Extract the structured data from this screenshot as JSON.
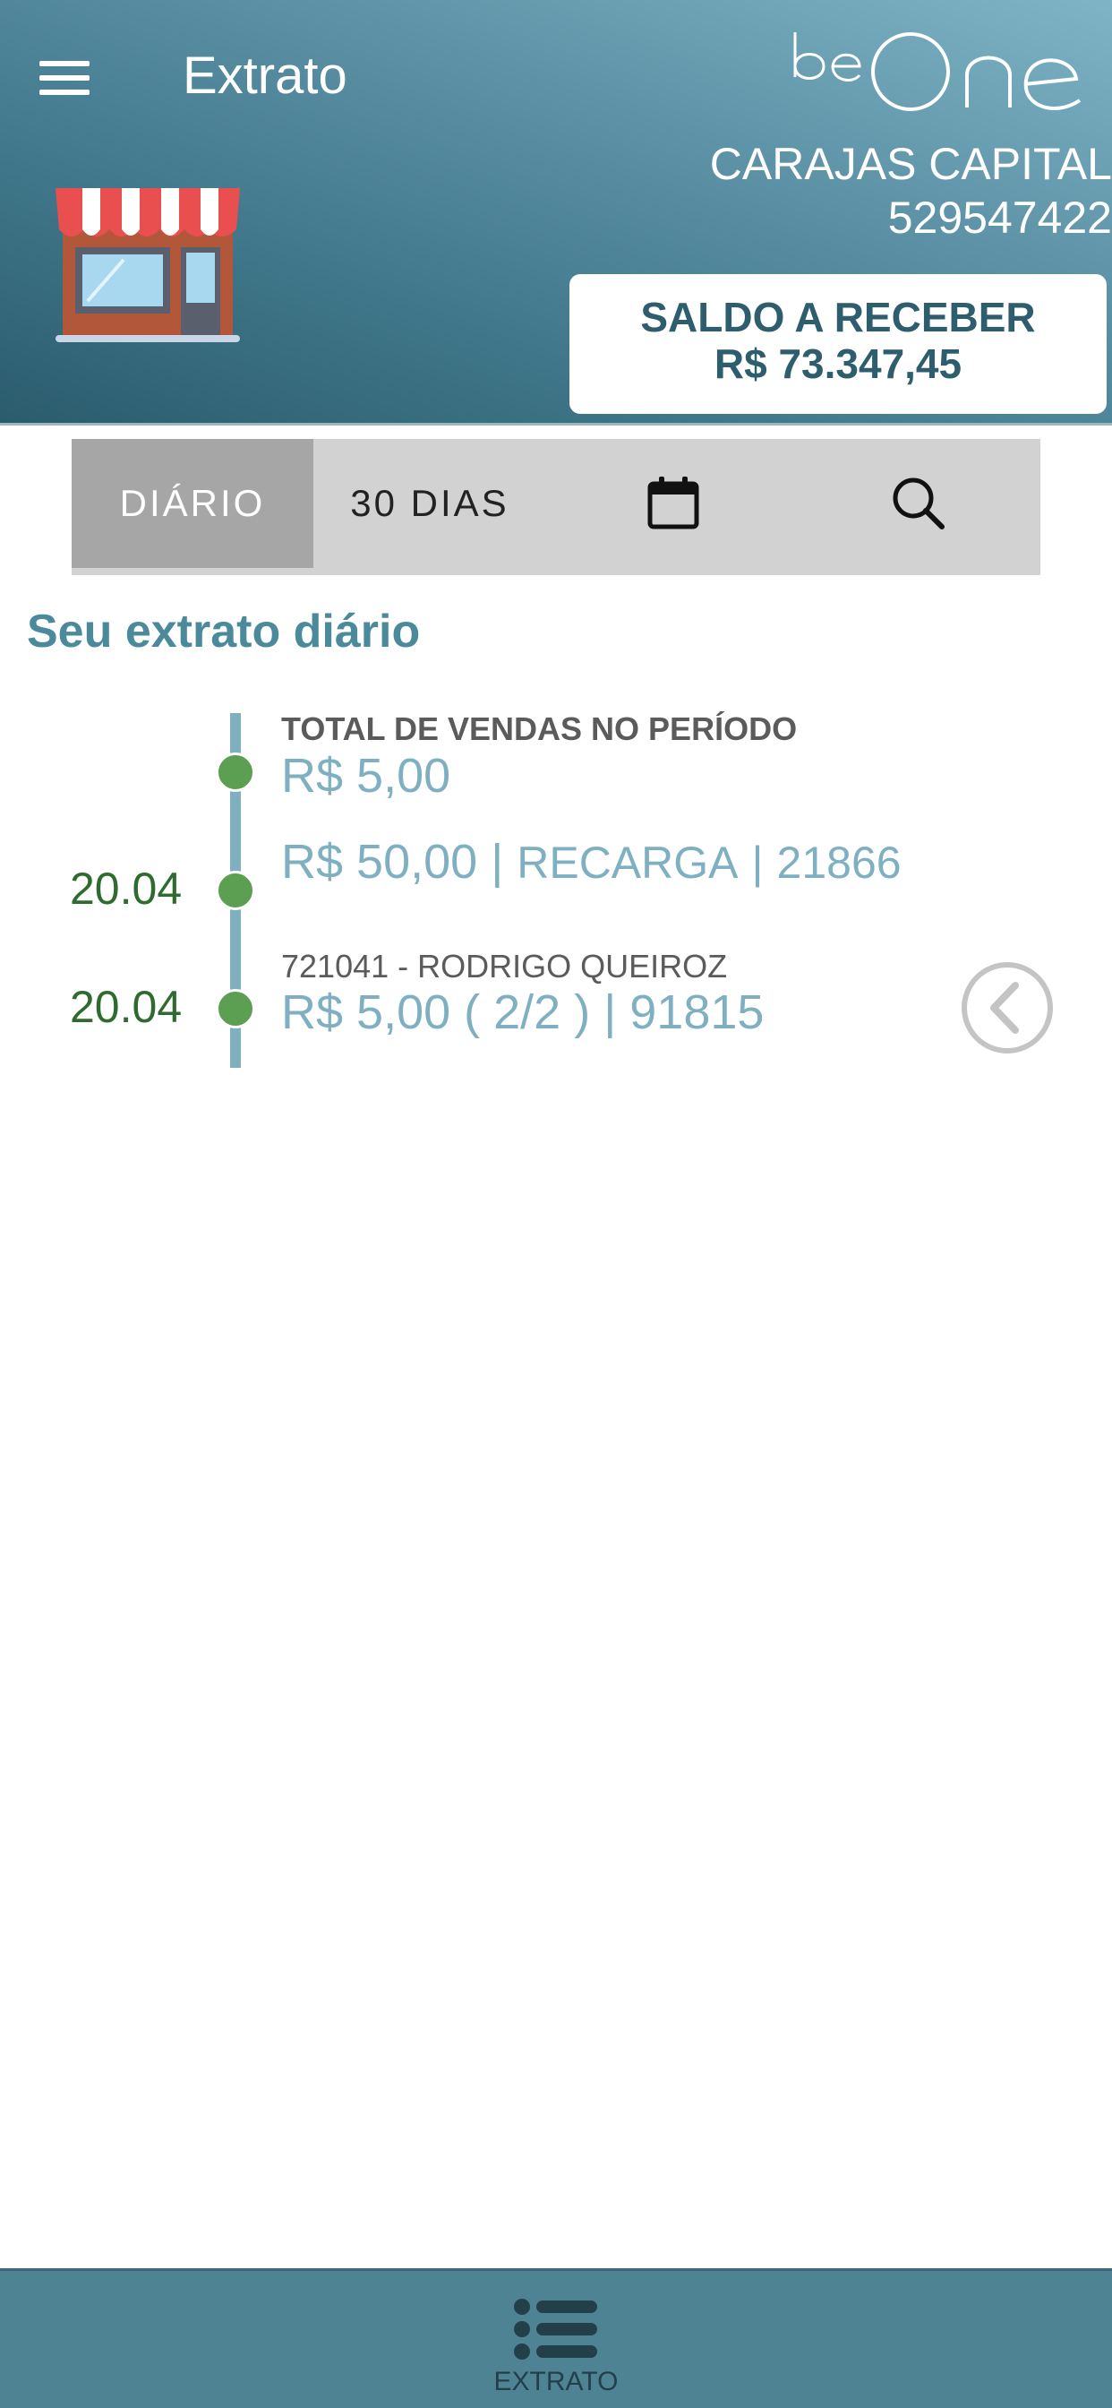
{
  "header": {
    "title": "Extrato",
    "logo_text": "beOne",
    "merchant_name": "CARAJAS CAPITAL",
    "merchant_id": "529547422",
    "balance_label": "SALDO A RECEBER",
    "balance_value": "R$ 73.347,45"
  },
  "tabs": {
    "daily_label": "DIÁRIO",
    "thirty_days_label": "30 DIAS",
    "active": "DIÁRIO"
  },
  "content": {
    "section_title": "Seu extrato diário",
    "total": {
      "label": "TOTAL DE VENDAS NO PERÍODO",
      "value": "R$ 5,00"
    },
    "transactions": [
      {
        "date": "20.04",
        "amount": "R$ 50,00",
        "type": "RECARGA",
        "code": "21866"
      },
      {
        "date": "20.04",
        "subtitle": "721041 - RODRIGO QUEIROZ",
        "amount": "R$ 5,00",
        "installment": "( 2/2 )",
        "code": "91815"
      }
    ]
  },
  "bottom_nav": {
    "items": [
      {
        "label": "EXTRATO",
        "icon": "list-icon"
      }
    ]
  },
  "colors": {
    "header_gradient_light": "#7fb3c6",
    "header_gradient_dark": "#2a5c6d",
    "accent_text": "#4a8a9a",
    "amount_text": "#7fb0c2",
    "date_text": "#2f6a2f",
    "timeline_dot": "#5c9e52",
    "bottom_nav": "#4e8394"
  }
}
